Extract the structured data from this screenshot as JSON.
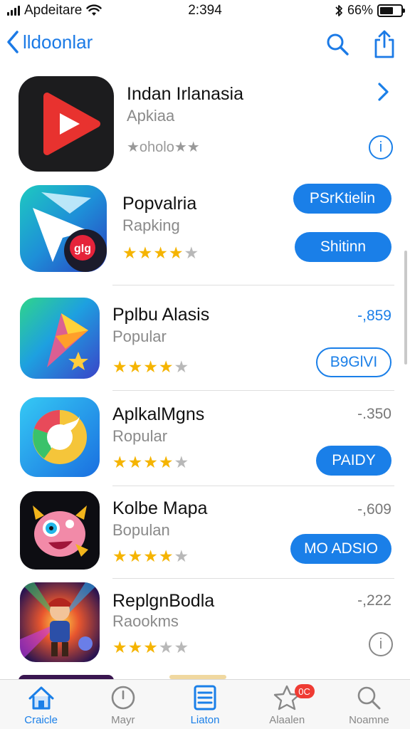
{
  "status_bar": {
    "carrier": "Apdeitare",
    "time": "2:394",
    "battery": "66%",
    "battery_level": 0.66
  },
  "nav": {
    "back_label": "lldoonlar"
  },
  "apps": [
    {
      "name": "Indan Irlanasia",
      "category": "Apkiaa",
      "rating_text": "★oholo★★",
      "action": "chevron",
      "info": "i"
    },
    {
      "name": "Popvalria",
      "category": "Rapking",
      "rating": 4,
      "buttons": [
        "PSrKtielin",
        "Shitinn"
      ]
    },
    {
      "name": "Pplbu Alasis",
      "category": "Popular",
      "rating": 4,
      "price": "-,859",
      "button_outline": "B9GlVI"
    },
    {
      "name": "AplkalMgns",
      "category": "Ropular",
      "rating": 4,
      "price": "-.350",
      "button": "PAIDY"
    },
    {
      "name": "Kolbe Mapa",
      "category": "Bopulan",
      "rating": 4,
      "price": "-,609",
      "button": "MO ADSIO"
    },
    {
      "name": "ReplgnBodla",
      "category": "Raookms",
      "rating": 3,
      "price": "-,222",
      "info": "i"
    }
  ],
  "tabs": [
    {
      "label": "Craicle",
      "icon": "home-icon",
      "active": true
    },
    {
      "label": "Mayr",
      "icon": "clock-icon",
      "active": false
    },
    {
      "label": "Liaton",
      "icon": "list-icon",
      "active": true
    },
    {
      "label": "Alaalen",
      "icon": "star-icon",
      "active": false,
      "badge": "0C"
    },
    {
      "label": "Noamne",
      "icon": "search-icon",
      "active": false
    }
  ],
  "colors": {
    "accent": "#1a7fe8",
    "star": "#f5b400",
    "badge": "#ef3b33"
  }
}
